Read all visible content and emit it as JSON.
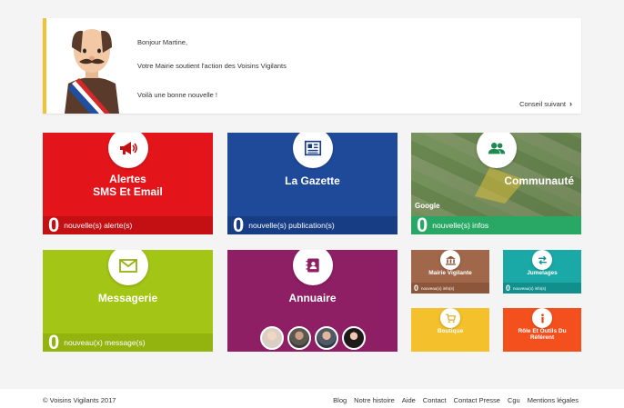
{
  "message": {
    "greeting": "Bonjour Martine,",
    "line1": "Votre Mairie soutient l'action des Voisins Vigilants",
    "line2": "Voilà une bonne nouvelle !",
    "next_label": "Conseil suivant"
  },
  "tiles": {
    "alertes": {
      "title_line1": "Alertes",
      "title_line2": "SMS Et Email",
      "count": "0",
      "count_label": "nouvelle(s) alerte(s)",
      "color": "#e3151a",
      "bar_color": "#c40f13",
      "icon": "megaphone-icon"
    },
    "gazette": {
      "title": "La Gazette",
      "count": "0",
      "count_label": "nouvelle(s) publication(s)",
      "color": "#1f4a9a",
      "bar_color": "#173d85",
      "icon": "newspaper-icon"
    },
    "communaute": {
      "title": "Communauté",
      "count": "0",
      "count_label": "nouvelle(s) infos",
      "map_brand": "Google",
      "bar_color": "#28a864",
      "icon": "users-icon"
    },
    "messagerie": {
      "title": "Messagerie",
      "count": "0",
      "count_label": "nouveau(x) message(s)",
      "color": "#a3c515",
      "bar_color": "#93b30f",
      "icon": "envelope-icon"
    },
    "annuaire": {
      "title": "Annuaire",
      "color": "#8e1f64",
      "icon": "address-book-icon"
    },
    "mairie": {
      "title": "Mairie Vigilante",
      "count": "0",
      "count_label": "nouveau(x) info(s)",
      "color": "#a0674a",
      "bar_color": "#8b5639",
      "icon": "townhall-icon"
    },
    "jumelages": {
      "title": "Jumelages",
      "count": "0",
      "count_label": "nouveau(x) info(s)",
      "color": "#1aa9a6",
      "bar_color": "#118f8c",
      "icon": "exchange-icon"
    },
    "boutique": {
      "title": "Boutique",
      "color": "#f4c02c",
      "icon": "cart-icon"
    },
    "referent": {
      "title_line1": "Rôle Et Outils Du",
      "title_line2": "Référent",
      "color": "#f4501e",
      "icon": "info-icon"
    }
  },
  "footer": {
    "copyright": "© Voisins Vigilants 2017",
    "links": [
      "Blog",
      "Notre histoire",
      "Aide",
      "Contact",
      "Contact Presse",
      "Cgu",
      "Mentions légales"
    ]
  }
}
